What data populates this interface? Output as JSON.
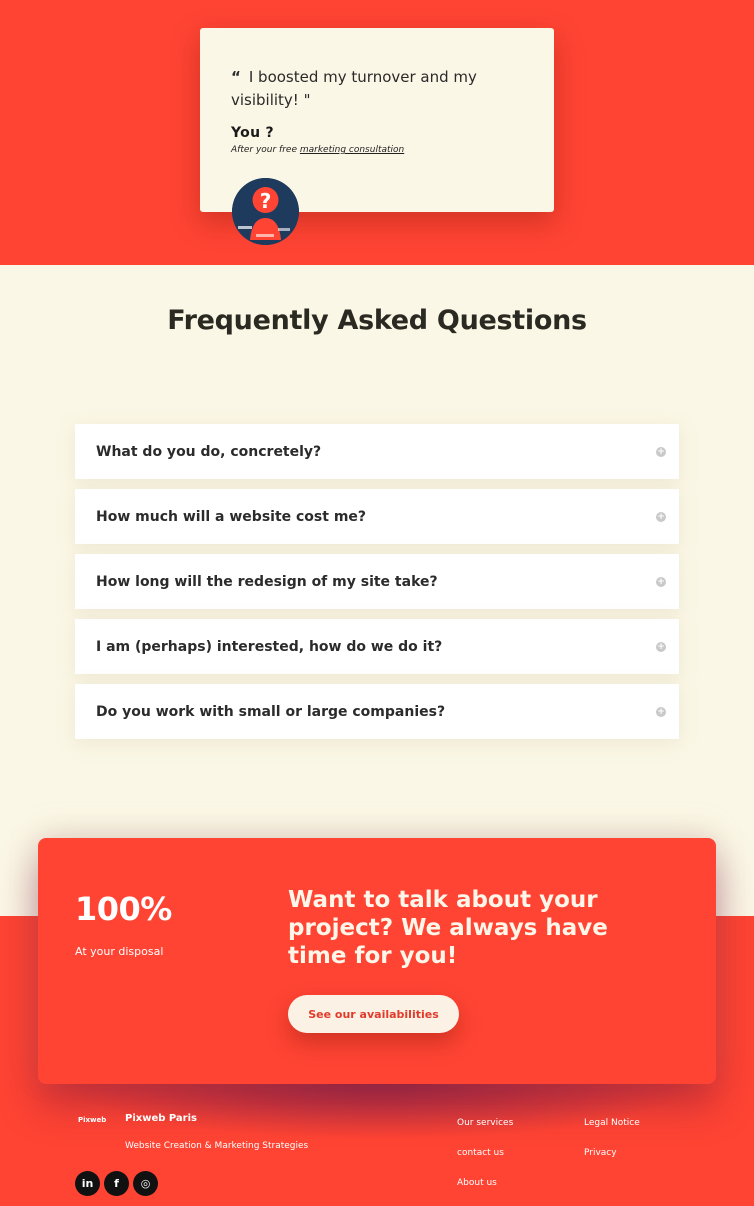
{
  "testimonial": {
    "quote_mark": "“",
    "quote": "I boosted my turnover and my visibility! \"",
    "author": "You ?",
    "sub_prefix": "After your free ",
    "sub_link": "marketing consultation"
  },
  "faq": {
    "title": "Frequently Asked Questions",
    "items": [
      {
        "question": "What do you do, concretely?"
      },
      {
        "question": "How much will a website cost me?"
      },
      {
        "question": "How long will the redesign of my site take?"
      },
      {
        "question": "I am (perhaps) interested, how do we do it?"
      },
      {
        "question": "Do you work with small or large companies?"
      }
    ],
    "expand_icon": "plus-circle-icon"
  },
  "cta": {
    "stat_value": "100%",
    "stat_label": "At your disposal",
    "heading": "Want to talk about your project? We always have time for you!",
    "button_label": "See our availabilities"
  },
  "footer": {
    "logo_text": "Pixweb",
    "brand_name": "Pixweb Paris",
    "tagline": "Website Creation & Marketing Strategies",
    "social": [
      {
        "icon": "linkedin-icon",
        "glyph": "in"
      },
      {
        "icon": "facebook-icon",
        "glyph": "f"
      },
      {
        "icon": "instagram-icon",
        "glyph": "◎"
      }
    ],
    "links_col1": [
      "Our services",
      "contact us",
      "About us"
    ],
    "links_col2": [
      "Legal Notice",
      "Privacy"
    ]
  },
  "colors": {
    "accent_red": "#ff4433",
    "cream": "#fbf7e6",
    "navy": "#1e3a5c"
  }
}
